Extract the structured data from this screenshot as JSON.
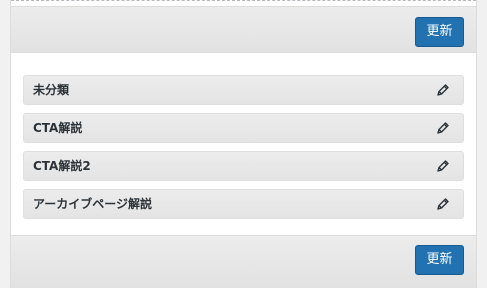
{
  "buttons": {
    "update_top": "更新",
    "update_bottom": "更新"
  },
  "items": [
    {
      "label": "未分類",
      "icon": "pencil-icon"
    },
    {
      "label": "CTA解説",
      "icon": "pencil-icon"
    },
    {
      "label": "CTA解説2",
      "icon": "pencil-icon"
    },
    {
      "label": "アーカイブページ解説",
      "icon": "pencil-icon"
    }
  ],
  "colors": {
    "button_bg": "#2271b1",
    "item_bg": "#e8e8e8",
    "bar_bg": "#e5e5e5"
  }
}
